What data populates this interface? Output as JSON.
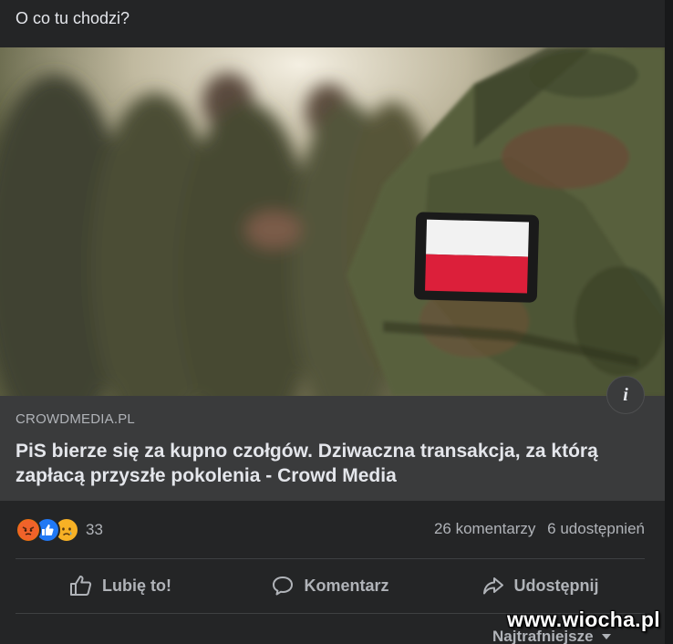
{
  "post": {
    "text": "O co tu chodzi?"
  },
  "link_preview": {
    "domain": "CROWDMEDIA.PL",
    "title": "PiS bierze się za kupno czołgów. Dziwaczna transakcja, za którą zapłacą przyszłe pokolenia - Crowd Media",
    "info_icon": "i"
  },
  "stats": {
    "reactions": [
      "angry",
      "like",
      "sad"
    ],
    "reaction_count": "33",
    "comments": "26 komentarzy",
    "shares": "6 udostępnień"
  },
  "actions": {
    "like_label": "Lubię to!",
    "comment_label": "Komentarz",
    "share_label": "Udostępnij"
  },
  "comments_sort": {
    "label": "Najtrafniejsze"
  },
  "watermark": "www.wiocha.pl",
  "colors": {
    "background": "#18191a",
    "card": "#242526",
    "link_box": "#3a3b3c",
    "text_primary": "#e4e6eb",
    "text_secondary": "#b0b3b8",
    "like_blue": "#2078f4",
    "angry_orange": "#e9710f",
    "sad_yellow": "#f7b125"
  }
}
